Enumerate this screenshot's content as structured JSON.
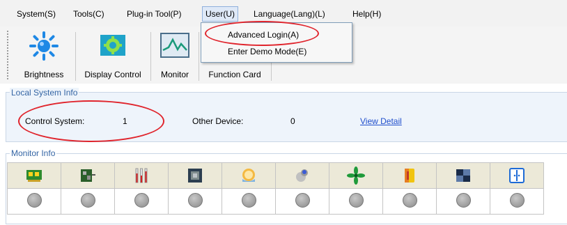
{
  "menu": {
    "items": [
      {
        "label": "System(S)"
      },
      {
        "label": "Tools(C)"
      },
      {
        "label": "Plug-in Tool(P)"
      },
      {
        "label": "User(U)"
      },
      {
        "label": "Language(Lang)(L)"
      },
      {
        "label": "Help(H)"
      }
    ],
    "user_dropdown": [
      {
        "label": "Advanced Login(A)"
      },
      {
        "label": "Enter Demo Mode(E)"
      }
    ]
  },
  "toolbar": {
    "buttons": [
      {
        "label": "Brightness",
        "icon": "brightness-icon"
      },
      {
        "label": "Display Control",
        "icon": "display-control-icon"
      },
      {
        "label": "Monitor",
        "icon": "monitor-icon"
      },
      {
        "label": "Function Card",
        "icon": ""
      }
    ]
  },
  "local_info": {
    "title": "Local System Info",
    "control_label": "Control System:",
    "control_value": "1",
    "other_label": "Other Device:",
    "other_value": "0",
    "link": "View Detail"
  },
  "monitor_info": {
    "title": "Monitor Info",
    "icons": [
      "receiving-card-icon",
      "sending-card-icon",
      "temperature-icon",
      "cpu-icon",
      "humidity-icon",
      "smoke-icon",
      "fan-icon",
      "power-supply-icon",
      "module-icon",
      "cabinet-door-icon"
    ]
  },
  "colors": {
    "annotation": "#e0242c",
    "link": "#1f4ecc",
    "group_title": "#3465a4"
  }
}
